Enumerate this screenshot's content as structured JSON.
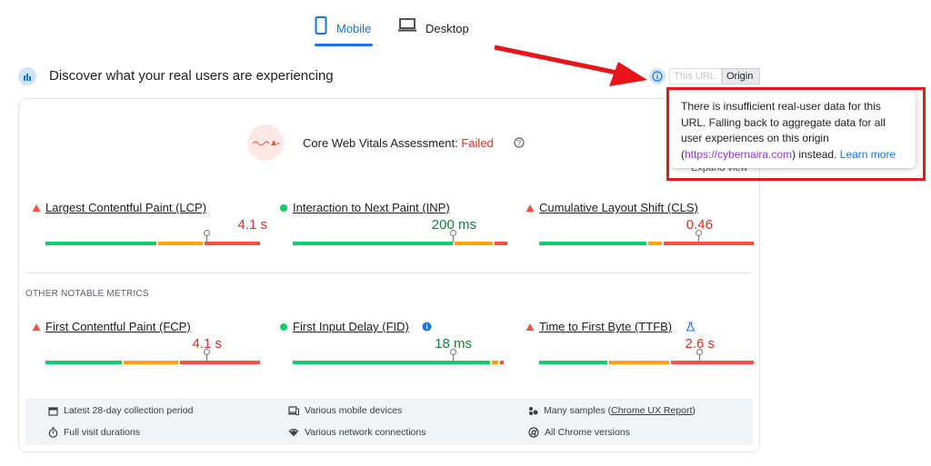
{
  "tabs": {
    "mobile": "Mobile",
    "desktop": "Desktop"
  },
  "section": {
    "title": "Discover what your real users are experiencing",
    "toggle": {
      "this_url": "This URL",
      "origin": "Origin"
    }
  },
  "tooltip": {
    "text_before": "There is insufficient real-user data for this URL. Falling back to aggregate data for all user experiences on this origin (",
    "origin_url": "https://cybernaira.com",
    "text_after": ") instead.",
    "learn_more": "Learn more"
  },
  "assessment": {
    "label": "Core Web Vitals Assessment: ",
    "status": "Failed",
    "expand": "Expand view"
  },
  "core_metrics": [
    {
      "name": "Largest Contentful Paint (LCP)",
      "value": "4.1 s",
      "status": "poor"
    },
    {
      "name": "Interaction to Next Paint (INP)",
      "value": "200 ms",
      "status": "good"
    },
    {
      "name": "Cumulative Layout Shift (CLS)",
      "value": "0.46",
      "status": "poor"
    }
  ],
  "other_label": "OTHER NOTABLE METRICS",
  "other_metrics": [
    {
      "name": "First Contentful Paint (FCP)",
      "value": "4.1 s",
      "status": "poor"
    },
    {
      "name": "First Input Delay (FID)",
      "value": "18 ms",
      "status": "good"
    },
    {
      "name": "Time to First Byte (TTFB)",
      "value": "2.6 s",
      "status": "poor"
    }
  ],
  "footer": {
    "period": "Latest 28-day collection period",
    "devices": "Various mobile devices",
    "samples_prefix": "Many samples (",
    "samples_link": "Chrome UX Report",
    "samples_suffix": ")",
    "durations": "Full visit durations",
    "network": "Various network connections",
    "versions": "All Chrome versions"
  },
  "colors": {
    "good": "#0cce6b",
    "average": "#ffa400",
    "poor": "#ff4e42",
    "poor_text": "#d93025",
    "good_text": "#188038",
    "accent": "#1a73e8"
  }
}
